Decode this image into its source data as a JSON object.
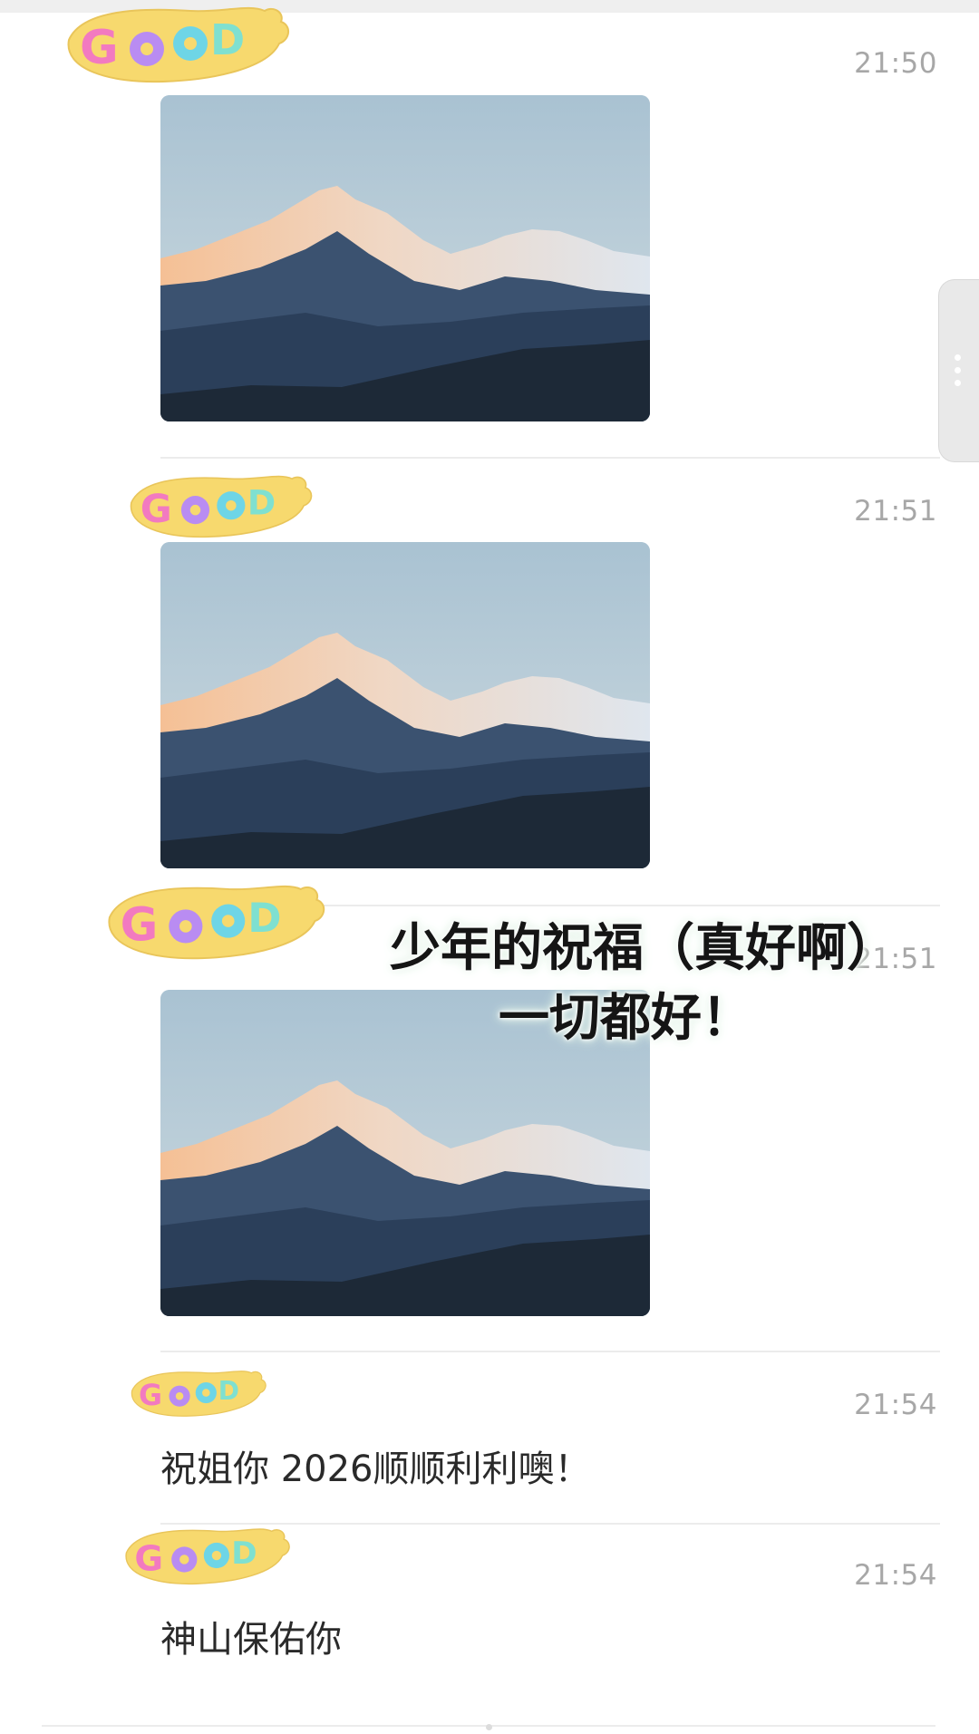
{
  "messages": [
    {
      "time": "21:50",
      "type": "image"
    },
    {
      "time": "21:51",
      "type": "image"
    },
    {
      "time": "21:51",
      "type": "image"
    },
    {
      "time": "21:54",
      "type": "text",
      "text": "祝姐你 2026顺顺利利噢！"
    },
    {
      "time": "21:54",
      "type": "text",
      "text": "神山保佑你"
    }
  ],
  "overlay": {
    "line1": "少年的祝福（真好啊）",
    "line2": "一切都好！"
  },
  "sticker": {
    "text": "GOOD",
    "colors": [
      "#f27ac0",
      "#b98cf2",
      "#6ed5e6",
      "#7fe0d0"
    ]
  },
  "colors": {
    "sticker_base": "#f7d96e",
    "time": "#a7a7a7",
    "sky": "#b9cdd8",
    "peak_glow": "#f3b07c"
  }
}
